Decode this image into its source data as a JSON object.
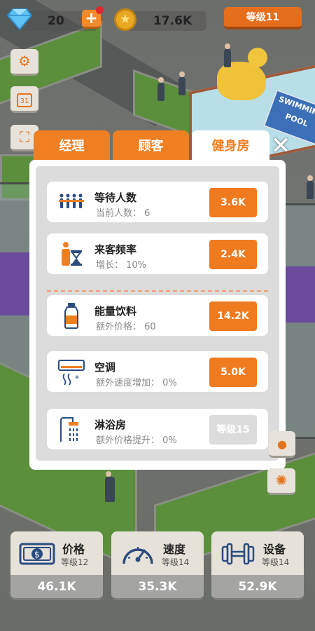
{
  "top_bar": {
    "gems": "20",
    "coins": "17.6K",
    "level_label": "等级11"
  },
  "scene": {
    "pool_sign": "SWIMMING POOL",
    "calendar_day": "31"
  },
  "tabs": [
    {
      "label": "经理",
      "active": false
    },
    {
      "label": "顾客",
      "active": false
    },
    {
      "label": "健身房",
      "active": true
    }
  ],
  "close_label": "✕",
  "rows": [
    {
      "title": "等待人数",
      "sub": "当前人数： 6",
      "button": "3.6K",
      "locked": false,
      "icon": "queue-people-icon"
    },
    {
      "title": "来客频率",
      "sub": "增长： 10%",
      "button": "2.4K",
      "locked": false,
      "icon": "hourglass-person-icon"
    },
    {
      "title": "能量饮料",
      "sub": "额外价格： 60",
      "button": "14.2K",
      "locked": false,
      "icon": "drink-bottle-icon"
    },
    {
      "title": "空调",
      "sub": "额外速度增加： 0%",
      "button": "5.0K",
      "locked": false,
      "icon": "air-conditioner-icon"
    },
    {
      "title": "淋浴房",
      "sub": "额外价格提升： 0%",
      "button": "等级15",
      "locked": true,
      "icon": "shower-icon"
    }
  ],
  "cards": [
    {
      "name": "价格",
      "level": "等级12",
      "cost": "46.1K",
      "icon": "money-icon"
    },
    {
      "name": "速度",
      "level": "等级14",
      "cost": "35.3K",
      "icon": "speedometer-icon"
    },
    {
      "name": "设备",
      "level": "等级14",
      "cost": "52.9K",
      "icon": "dumbbell-icon"
    }
  ],
  "colors": {
    "accent": "#f07f22",
    "button": "#f07a1e",
    "locked": "#dcdcdc",
    "panel_bg": "#ffffff"
  }
}
